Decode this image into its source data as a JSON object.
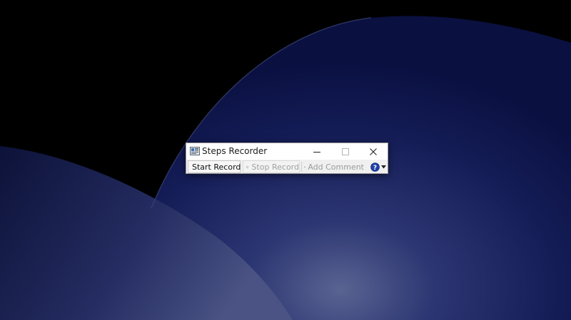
{
  "window": {
    "title": "Steps Recorder",
    "app_icon": "steps-recorder-icon"
  },
  "caption_buttons": {
    "minimize_icon": "minimize-icon",
    "maximize_icon": "maximize-icon",
    "close_icon": "close-icon"
  },
  "toolbar": {
    "start_record": {
      "label": "Start Record",
      "icon": "record-icon",
      "enabled": true
    },
    "stop_record": {
      "label": "Stop Record",
      "icon": "stop-icon",
      "enabled": false
    },
    "add_comment": {
      "label": "Add Comment",
      "icon": "comment-icon",
      "enabled": false
    },
    "help": {
      "icon": "help-icon",
      "dropdown_icon": "chevron-down-icon"
    }
  },
  "colors": {
    "record_red": "#d9232e",
    "help_blue": "#1f3fa8",
    "wallpaper_navy": "#0b1240"
  }
}
